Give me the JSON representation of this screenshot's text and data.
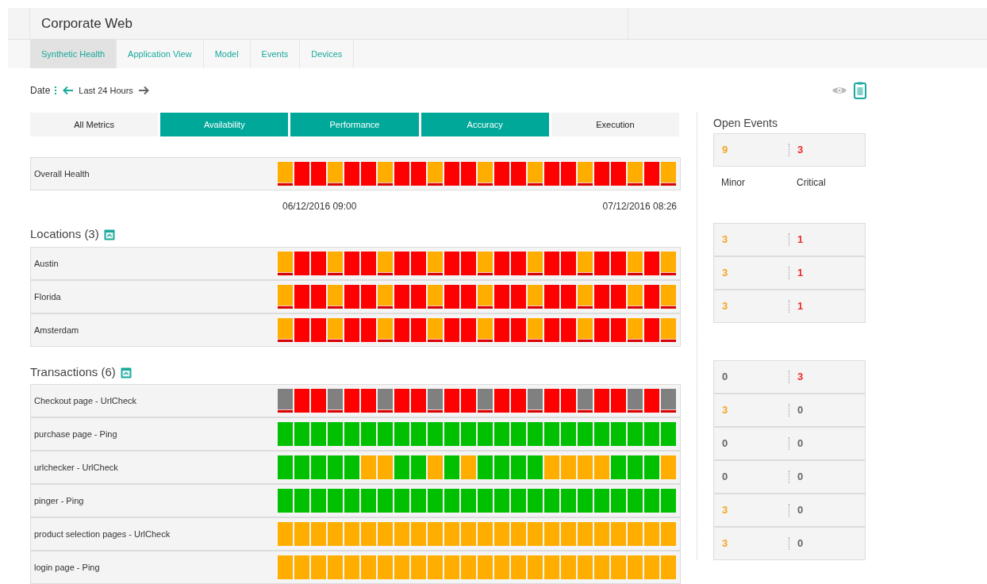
{
  "title": "Corporate Web",
  "tabs": [
    {
      "label": "Synthetic Health",
      "selected": true
    },
    {
      "label": "Application View",
      "selected": false
    },
    {
      "label": "Model",
      "selected": false
    },
    {
      "label": "Events",
      "selected": false
    },
    {
      "label": "Devices",
      "selected": false
    }
  ],
  "date": {
    "label": "Date",
    "range": "Last 24 Hours"
  },
  "metric_tabs": [
    {
      "label": "All Metrics",
      "selected": false
    },
    {
      "label": "Availability",
      "selected": true
    },
    {
      "label": "Performance",
      "selected": true
    },
    {
      "label": "Accuracy",
      "selected": true
    },
    {
      "label": "Execution",
      "selected": false
    }
  ],
  "open_events": {
    "title": "Open Events",
    "minor_label": "Minor",
    "critical_label": "Critical"
  },
  "overall": {
    "name": "Overall Health",
    "cells": [
      {
        "color": "#ffae00",
        "flagged": true
      },
      {
        "color": "#ff0000",
        "flagged": false
      },
      {
        "color": "#ff0000",
        "flagged": false
      },
      {
        "color": "#ffae00",
        "flagged": true
      },
      {
        "color": "#ff0000",
        "flagged": false
      },
      {
        "color": "#ff0000",
        "flagged": false
      },
      {
        "color": "#ffae00",
        "flagged": true
      },
      {
        "color": "#ff0000",
        "flagged": false
      },
      {
        "color": "#ff0000",
        "flagged": false
      },
      {
        "color": "#ffae00",
        "flagged": true
      },
      {
        "color": "#ff0000",
        "flagged": false
      },
      {
        "color": "#ff0000",
        "flagged": false
      },
      {
        "color": "#ffae00",
        "flagged": true
      },
      {
        "color": "#ff0000",
        "flagged": false
      },
      {
        "color": "#ff0000",
        "flagged": false
      },
      {
        "color": "#ffae00",
        "flagged": true
      },
      {
        "color": "#ff0000",
        "flagged": false
      },
      {
        "color": "#ff0000",
        "flagged": false
      },
      {
        "color": "#ffae00",
        "flagged": true
      },
      {
        "color": "#ff0000",
        "flagged": false
      },
      {
        "color": "#ff0000",
        "flagged": false
      },
      {
        "color": "#ffae00",
        "flagged": true
      },
      {
        "color": "#ff0000",
        "flagged": false
      },
      {
        "color": "#ffae00",
        "flagged": true
      }
    ],
    "events": {
      "minor": {
        "value": "9",
        "color": "#f5a623"
      },
      "critical": {
        "value": "3",
        "color": "#ee2b2b"
      }
    }
  },
  "time_start": "06/12/2016 09:00",
  "time_end": "07/12/2016 08:26",
  "sections": [
    {
      "title": "Locations (3)",
      "rows": [
        {
          "name": "Austin",
          "cells": [
            {
              "color": "#ffae00",
              "flagged": true
            },
            {
              "color": "#ff0000",
              "flagged": false
            },
            {
              "color": "#ff0000",
              "flagged": false
            },
            {
              "color": "#ffae00",
              "flagged": true
            },
            {
              "color": "#ff0000",
              "flagged": false
            },
            {
              "color": "#ff0000",
              "flagged": false
            },
            {
              "color": "#ffae00",
              "flagged": true
            },
            {
              "color": "#ff0000",
              "flagged": false
            },
            {
              "color": "#ff0000",
              "flagged": false
            },
            {
              "color": "#ffae00",
              "flagged": true
            },
            {
              "color": "#ff0000",
              "flagged": false
            },
            {
              "color": "#ff0000",
              "flagged": false
            },
            {
              "color": "#ffae00",
              "flagged": true
            },
            {
              "color": "#ff0000",
              "flagged": false
            },
            {
              "color": "#ff0000",
              "flagged": false
            },
            {
              "color": "#ffae00",
              "flagged": true
            },
            {
              "color": "#ff0000",
              "flagged": false
            },
            {
              "color": "#ff0000",
              "flagged": false
            },
            {
              "color": "#ffae00",
              "flagged": true
            },
            {
              "color": "#ff0000",
              "flagged": false
            },
            {
              "color": "#ff0000",
              "flagged": false
            },
            {
              "color": "#ffae00",
              "flagged": true
            },
            {
              "color": "#ff0000",
              "flagged": false
            },
            {
              "color": "#ffae00",
              "flagged": true
            }
          ],
          "events": {
            "minor": {
              "value": "3",
              "color": "#f5a623"
            },
            "critical": {
              "value": "1",
              "color": "#ee2b2b"
            }
          }
        },
        {
          "name": "Florida",
          "cells": [
            {
              "color": "#ffae00",
              "flagged": true
            },
            {
              "color": "#ff0000",
              "flagged": false
            },
            {
              "color": "#ff0000",
              "flagged": false
            },
            {
              "color": "#ffae00",
              "flagged": true
            },
            {
              "color": "#ff0000",
              "flagged": false
            },
            {
              "color": "#ff0000",
              "flagged": false
            },
            {
              "color": "#ffae00",
              "flagged": true
            },
            {
              "color": "#ff0000",
              "flagged": false
            },
            {
              "color": "#ff0000",
              "flagged": false
            },
            {
              "color": "#ffae00",
              "flagged": true
            },
            {
              "color": "#ff0000",
              "flagged": false
            },
            {
              "color": "#ff0000",
              "flagged": false
            },
            {
              "color": "#ffae00",
              "flagged": true
            },
            {
              "color": "#ff0000",
              "flagged": false
            },
            {
              "color": "#ff0000",
              "flagged": false
            },
            {
              "color": "#ffae00",
              "flagged": true
            },
            {
              "color": "#ff0000",
              "flagged": false
            },
            {
              "color": "#ff0000",
              "flagged": false
            },
            {
              "color": "#ffae00",
              "flagged": true
            },
            {
              "color": "#ff0000",
              "flagged": false
            },
            {
              "color": "#ff0000",
              "flagged": false
            },
            {
              "color": "#ffae00",
              "flagged": true
            },
            {
              "color": "#ff0000",
              "flagged": false
            },
            {
              "color": "#ffae00",
              "flagged": true
            }
          ],
          "events": {
            "minor": {
              "value": "3",
              "color": "#f5a623"
            },
            "critical": {
              "value": "1",
              "color": "#ee2b2b"
            }
          }
        },
        {
          "name": "Amsterdam",
          "cells": [
            {
              "color": "#ffae00",
              "flagged": true
            },
            {
              "color": "#ff0000",
              "flagged": false
            },
            {
              "color": "#ff0000",
              "flagged": false
            },
            {
              "color": "#ffae00",
              "flagged": true
            },
            {
              "color": "#ff0000",
              "flagged": false
            },
            {
              "color": "#ff0000",
              "flagged": false
            },
            {
              "color": "#ffae00",
              "flagged": true
            },
            {
              "color": "#ff0000",
              "flagged": false
            },
            {
              "color": "#ff0000",
              "flagged": false
            },
            {
              "color": "#ffae00",
              "flagged": true
            },
            {
              "color": "#ff0000",
              "flagged": false
            },
            {
              "color": "#ff0000",
              "flagged": false
            },
            {
              "color": "#ffae00",
              "flagged": true
            },
            {
              "color": "#ff0000",
              "flagged": false
            },
            {
              "color": "#ff0000",
              "flagged": false
            },
            {
              "color": "#ffae00",
              "flagged": true
            },
            {
              "color": "#ff0000",
              "flagged": false
            },
            {
              "color": "#ff0000",
              "flagged": false
            },
            {
              "color": "#ffae00",
              "flagged": true
            },
            {
              "color": "#ff0000",
              "flagged": false
            },
            {
              "color": "#ff0000",
              "flagged": false
            },
            {
              "color": "#ffae00",
              "flagged": true
            },
            {
              "color": "#ff0000",
              "flagged": false
            },
            {
              "color": "#ffae00",
              "flagged": true
            }
          ],
          "events": {
            "minor": {
              "value": "3",
              "color": "#f5a623"
            },
            "critical": {
              "value": "1",
              "color": "#ee2b2b"
            }
          }
        }
      ]
    },
    {
      "title": "Transactions (6)",
      "rows": [
        {
          "name": "Checkout page - UrlCheck",
          "cells": [
            {
              "color": "#808080",
              "flagged": true
            },
            {
              "color": "#ff0000",
              "flagged": false
            },
            {
              "color": "#ff0000",
              "flagged": false
            },
            {
              "color": "#808080",
              "flagged": true
            },
            {
              "color": "#ff0000",
              "flagged": false
            },
            {
              "color": "#ff0000",
              "flagged": false
            },
            {
              "color": "#808080",
              "flagged": true
            },
            {
              "color": "#ff0000",
              "flagged": false
            },
            {
              "color": "#ff0000",
              "flagged": false
            },
            {
              "color": "#808080",
              "flagged": true
            },
            {
              "color": "#ff0000",
              "flagged": false
            },
            {
              "color": "#ff0000",
              "flagged": false
            },
            {
              "color": "#808080",
              "flagged": true
            },
            {
              "color": "#ff0000",
              "flagged": false
            },
            {
              "color": "#ff0000",
              "flagged": false
            },
            {
              "color": "#808080",
              "flagged": true
            },
            {
              "color": "#ff0000",
              "flagged": false
            },
            {
              "color": "#ff0000",
              "flagged": false
            },
            {
              "color": "#808080",
              "flagged": true
            },
            {
              "color": "#ff0000",
              "flagged": false
            },
            {
              "color": "#ff0000",
              "flagged": false
            },
            {
              "color": "#808080",
              "flagged": true
            },
            {
              "color": "#ff0000",
              "flagged": false
            },
            {
              "color": "#808080",
              "flagged": true
            }
          ],
          "events": {
            "minor": {
              "value": "0",
              "color": "#666666"
            },
            "critical": {
              "value": "3",
              "color": "#ee2b2b"
            }
          }
        },
        {
          "name": "purchase page - Ping",
          "cells": [
            {
              "color": "#00c000",
              "flagged": false
            },
            {
              "color": "#00c000",
              "flagged": false
            },
            {
              "color": "#00c000",
              "flagged": false
            },
            {
              "color": "#00c000",
              "flagged": false
            },
            {
              "color": "#00c000",
              "flagged": false
            },
            {
              "color": "#00c000",
              "flagged": false
            },
            {
              "color": "#00c000",
              "flagged": false
            },
            {
              "color": "#00c000",
              "flagged": false
            },
            {
              "color": "#00c000",
              "flagged": false
            },
            {
              "color": "#00c000",
              "flagged": false
            },
            {
              "color": "#00c000",
              "flagged": false
            },
            {
              "color": "#00c000",
              "flagged": false
            },
            {
              "color": "#00c000",
              "flagged": false
            },
            {
              "color": "#00c000",
              "flagged": false
            },
            {
              "color": "#00c000",
              "flagged": false
            },
            {
              "color": "#00c000",
              "flagged": false
            },
            {
              "color": "#00c000",
              "flagged": false
            },
            {
              "color": "#00c000",
              "flagged": false
            },
            {
              "color": "#00c000",
              "flagged": false
            },
            {
              "color": "#00c000",
              "flagged": false
            },
            {
              "color": "#00c000",
              "flagged": false
            },
            {
              "color": "#00c000",
              "flagged": false
            },
            {
              "color": "#00c000",
              "flagged": false
            },
            {
              "color": "#00c000",
              "flagged": false
            }
          ],
          "events": {
            "minor": {
              "value": "3",
              "color": "#f5a623"
            },
            "critical": {
              "value": "0",
              "color": "#666666"
            }
          }
        },
        {
          "name": "urlchecker - UrlCheck",
          "cells": [
            {
              "color": "#00c000",
              "flagged": false
            },
            {
              "color": "#00c000",
              "flagged": false
            },
            {
              "color": "#00c000",
              "flagged": false
            },
            {
              "color": "#00c000",
              "flagged": false
            },
            {
              "color": "#00c000",
              "flagged": false
            },
            {
              "color": "#ffae00",
              "flagged": false
            },
            {
              "color": "#ffae00",
              "flagged": false
            },
            {
              "color": "#00c000",
              "flagged": false
            },
            {
              "color": "#00c000",
              "flagged": false
            },
            {
              "color": "#ffae00",
              "flagged": false
            },
            {
              "color": "#00c000",
              "flagged": false
            },
            {
              "color": "#ffae00",
              "flagged": false
            },
            {
              "color": "#00c000",
              "flagged": false
            },
            {
              "color": "#00c000",
              "flagged": false
            },
            {
              "color": "#00c000",
              "flagged": false
            },
            {
              "color": "#00c000",
              "flagged": false
            },
            {
              "color": "#ffae00",
              "flagged": false
            },
            {
              "color": "#ffae00",
              "flagged": false
            },
            {
              "color": "#ffae00",
              "flagged": false
            },
            {
              "color": "#ffae00",
              "flagged": false
            },
            {
              "color": "#00c000",
              "flagged": false
            },
            {
              "color": "#00c000",
              "flagged": false
            },
            {
              "color": "#00c000",
              "flagged": false
            },
            {
              "color": "#ffae00",
              "flagged": false
            }
          ],
          "events": {
            "minor": {
              "value": "0",
              "color": "#666666"
            },
            "critical": {
              "value": "0",
              "color": "#666666"
            }
          }
        },
        {
          "name": "pinger - Ping",
          "cells": [
            {
              "color": "#00c000",
              "flagged": false
            },
            {
              "color": "#00c000",
              "flagged": false
            },
            {
              "color": "#00c000",
              "flagged": false
            },
            {
              "color": "#00c000",
              "flagged": false
            },
            {
              "color": "#00c000",
              "flagged": false
            },
            {
              "color": "#00c000",
              "flagged": false
            },
            {
              "color": "#00c000",
              "flagged": false
            },
            {
              "color": "#00c000",
              "flagged": false
            },
            {
              "color": "#00c000",
              "flagged": false
            },
            {
              "color": "#00c000",
              "flagged": false
            },
            {
              "color": "#00c000",
              "flagged": false
            },
            {
              "color": "#00c000",
              "flagged": false
            },
            {
              "color": "#00c000",
              "flagged": false
            },
            {
              "color": "#00c000",
              "flagged": false
            },
            {
              "color": "#00c000",
              "flagged": false
            },
            {
              "color": "#00c000",
              "flagged": false
            },
            {
              "color": "#00c000",
              "flagged": false
            },
            {
              "color": "#00c000",
              "flagged": false
            },
            {
              "color": "#00c000",
              "flagged": false
            },
            {
              "color": "#00c000",
              "flagged": false
            },
            {
              "color": "#00c000",
              "flagged": false
            },
            {
              "color": "#00c000",
              "flagged": false
            },
            {
              "color": "#00c000",
              "flagged": false
            },
            {
              "color": "#00c000",
              "flagged": false
            }
          ],
          "events": {
            "minor": {
              "value": "0",
              "color": "#666666"
            },
            "critical": {
              "value": "0",
              "color": "#666666"
            }
          }
        },
        {
          "name": "product selection pages - UrlCheck",
          "cells": [
            {
              "color": "#ffae00",
              "flagged": false
            },
            {
              "color": "#ffae00",
              "flagged": false
            },
            {
              "color": "#ffae00",
              "flagged": false
            },
            {
              "color": "#ffae00",
              "flagged": false
            },
            {
              "color": "#ffae00",
              "flagged": false
            },
            {
              "color": "#ffae00",
              "flagged": false
            },
            {
              "color": "#ffae00",
              "flagged": false
            },
            {
              "color": "#ffae00",
              "flagged": false
            },
            {
              "color": "#ffae00",
              "flagged": false
            },
            {
              "color": "#ffae00",
              "flagged": false
            },
            {
              "color": "#ffae00",
              "flagged": false
            },
            {
              "color": "#ffae00",
              "flagged": false
            },
            {
              "color": "#ffae00",
              "flagged": false
            },
            {
              "color": "#ffae00",
              "flagged": false
            },
            {
              "color": "#ffae00",
              "flagged": false
            },
            {
              "color": "#ffae00",
              "flagged": false
            },
            {
              "color": "#ffae00",
              "flagged": false
            },
            {
              "color": "#ffae00",
              "flagged": false
            },
            {
              "color": "#ffae00",
              "flagged": false
            },
            {
              "color": "#ffae00",
              "flagged": false
            },
            {
              "color": "#ffae00",
              "flagged": false
            },
            {
              "color": "#ffae00",
              "flagged": false
            },
            {
              "color": "#ffae00",
              "flagged": false
            },
            {
              "color": "#ffae00",
              "flagged": false
            }
          ],
          "events": {
            "minor": {
              "value": "3",
              "color": "#f5a623"
            },
            "critical": {
              "value": "0",
              "color": "#666666"
            }
          }
        },
        {
          "name": "login page - Ping",
          "cells": [
            {
              "color": "#ffae00",
              "flagged": false
            },
            {
              "color": "#ffae00",
              "flagged": false
            },
            {
              "color": "#ffae00",
              "flagged": false
            },
            {
              "color": "#ffae00",
              "flagged": false
            },
            {
              "color": "#ffae00",
              "flagged": false
            },
            {
              "color": "#ffae00",
              "flagged": false
            },
            {
              "color": "#ffae00",
              "flagged": false
            },
            {
              "color": "#ffae00",
              "flagged": false
            },
            {
              "color": "#ffae00",
              "flagged": false
            },
            {
              "color": "#ffae00",
              "flagged": false
            },
            {
              "color": "#ffae00",
              "flagged": false
            },
            {
              "color": "#ffae00",
              "flagged": false
            },
            {
              "color": "#ffae00",
              "flagged": false
            },
            {
              "color": "#ffae00",
              "flagged": false
            },
            {
              "color": "#ffae00",
              "flagged": false
            },
            {
              "color": "#ffae00",
              "flagged": false
            },
            {
              "color": "#ffae00",
              "flagged": false
            },
            {
              "color": "#ffae00",
              "flagged": false
            },
            {
              "color": "#ffae00",
              "flagged": false
            },
            {
              "color": "#ffae00",
              "flagged": false
            },
            {
              "color": "#ffae00",
              "flagged": false
            },
            {
              "color": "#ffae00",
              "flagged": false
            },
            {
              "color": "#ffae00",
              "flagged": false
            },
            {
              "color": "#ffae00",
              "flagged": false
            }
          ],
          "events": {
            "minor": {
              "value": "3",
              "color": "#f5a623"
            },
            "critical": {
              "value": "0",
              "color": "#666666"
            }
          }
        }
      ]
    }
  ]
}
